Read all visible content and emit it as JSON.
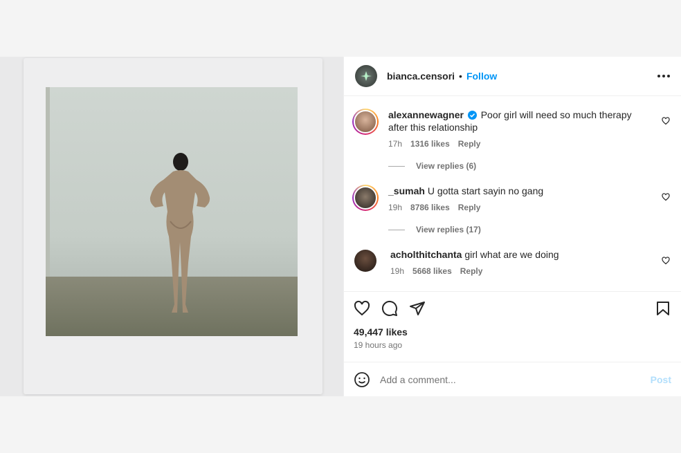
{
  "header": {
    "username": "bianca.censori",
    "separator": "•",
    "follow_label": "Follow"
  },
  "comments": [
    {
      "username": "alexannewagner",
      "verified": true,
      "text": "Poor girl will need so much therapy after this relationship",
      "age": "17h",
      "likes": "1316 likes",
      "reply_label": "Reply",
      "view_replies": "View replies (6)"
    },
    {
      "username": "_sumah",
      "verified": false,
      "text": "U gotta start sayin no gang",
      "age": "19h",
      "likes": "8786 likes",
      "reply_label": "Reply",
      "view_replies": "View replies (17)"
    },
    {
      "username": "acholthitchanta",
      "verified": false,
      "text": "girl what are we doing",
      "age": "19h",
      "likes": "5668 likes",
      "reply_label": "Reply"
    }
  ],
  "actions": {
    "likes": "49,447 likes",
    "time": "19 hours ago"
  },
  "add_comment": {
    "placeholder": "Add a comment...",
    "post_label": "Post"
  },
  "colors": {
    "accent": "#0095f6",
    "post_disabled": "#b2dffc",
    "verified": "#0095f6"
  },
  "icons": [
    "more-icon",
    "heart-icon",
    "comment-icon",
    "share-icon",
    "save-icon",
    "emoji-icon",
    "verified-icon"
  ]
}
